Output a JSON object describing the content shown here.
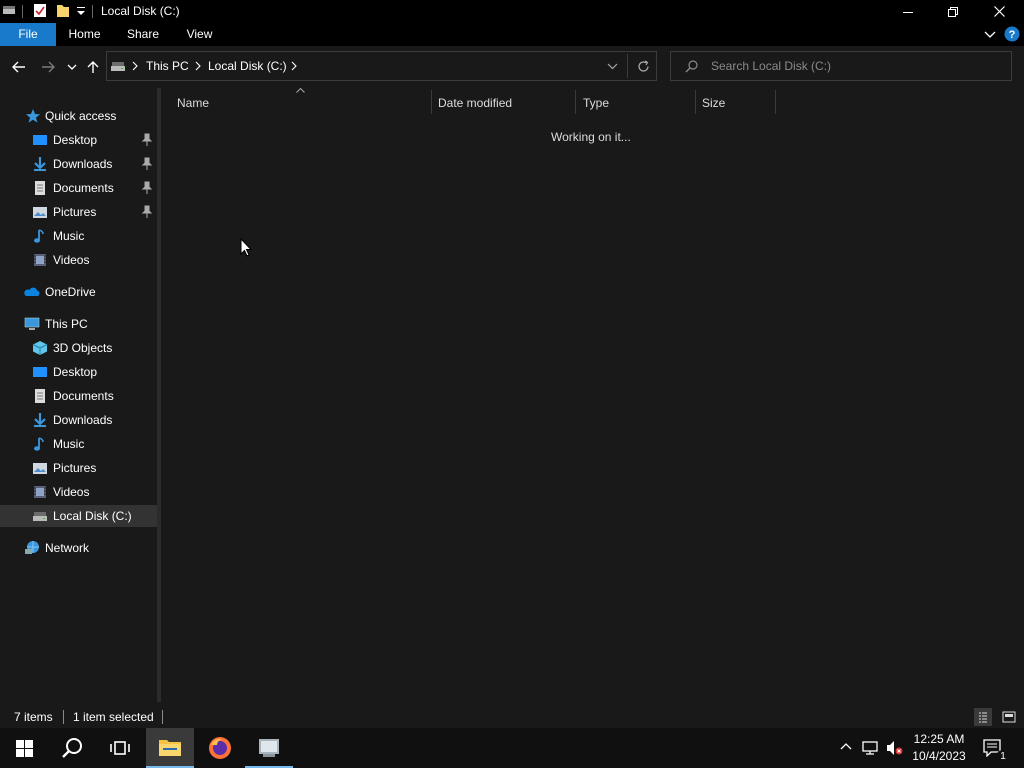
{
  "window": {
    "title": "Local Disk (C:)",
    "minimize_glyph": "—",
    "restore_glyph": "❐",
    "close_glyph": "✕"
  },
  "ribbon": {
    "tabs": [
      "File",
      "Home",
      "Share",
      "View"
    ],
    "accent": "#1979ca"
  },
  "address": {
    "crumbs": [
      "This PC",
      "Local Disk (C:)"
    ],
    "search_placeholder": "Search Local Disk (C:)"
  },
  "nav": {
    "quick_access": "Quick access",
    "quick_items": [
      {
        "label": "Desktop",
        "icon": "desktop-icon",
        "pinned": true
      },
      {
        "label": "Downloads",
        "icon": "downloads-icon",
        "pinned": true
      },
      {
        "label": "Documents",
        "icon": "documents-icon",
        "pinned": true
      },
      {
        "label": "Pictures",
        "icon": "pictures-icon",
        "pinned": true
      },
      {
        "label": "Music",
        "icon": "music-icon",
        "pinned": false
      },
      {
        "label": "Videos",
        "icon": "videos-icon",
        "pinned": false
      }
    ],
    "onedrive": "OneDrive",
    "this_pc": "This PC",
    "pc_items": [
      {
        "label": "3D Objects",
        "icon": "3d-objects-icon"
      },
      {
        "label": "Desktop",
        "icon": "desktop-icon"
      },
      {
        "label": "Documents",
        "icon": "documents-icon"
      },
      {
        "label": "Downloads",
        "icon": "downloads-icon"
      },
      {
        "label": "Music",
        "icon": "music-icon"
      },
      {
        "label": "Pictures",
        "icon": "pictures-icon"
      },
      {
        "label": "Videos",
        "icon": "videos-icon"
      },
      {
        "label": "Local Disk (C:)",
        "icon": "local-disk-icon",
        "selected": true
      }
    ],
    "network": "Network"
  },
  "content": {
    "columns": [
      "Name",
      "Date modified",
      "Type",
      "Size"
    ],
    "status_message": "Working on it..."
  },
  "status": {
    "item_count": "7 items",
    "selection": "1 item selected"
  },
  "taskbar": {
    "apps": [
      "file-explorer-icon",
      "firefox-icon",
      "other-app-icon"
    ],
    "time": "12:25 AM",
    "date": "10/4/2023",
    "notification_count": "1"
  }
}
